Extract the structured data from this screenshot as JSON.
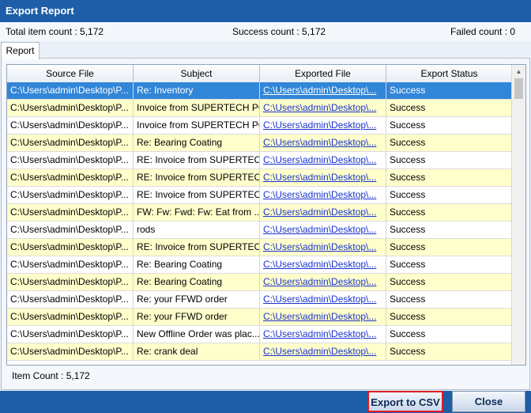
{
  "window": {
    "title": "Export Report"
  },
  "summary": {
    "total": "Total item count : 5,172",
    "success": "Success count : 5,172",
    "failed": "Failed count : 0"
  },
  "tabs": [
    {
      "label": "Report"
    }
  ],
  "table": {
    "headers": [
      "Source File",
      "Subject",
      "Exported File",
      "Export Status"
    ],
    "rows": [
      [
        "C:\\Users\\admin\\Desktop\\P...",
        "Re: Inventory",
        "C:\\Users\\admin\\Desktop\\...",
        "Success"
      ],
      [
        "C:\\Users\\admin\\Desktop\\P...",
        "Invoice from SUPERTECH PO...",
        "C:\\Users\\admin\\Desktop\\...",
        "Success"
      ],
      [
        "C:\\Users\\admin\\Desktop\\P...",
        "Invoice from SUPERTECH PO...",
        "C:\\Users\\admin\\Desktop\\...",
        "Success"
      ],
      [
        "C:\\Users\\admin\\Desktop\\P...",
        "Re: Bearing Coating",
        "C:\\Users\\admin\\Desktop\\...",
        "Success"
      ],
      [
        "C:\\Users\\admin\\Desktop\\P...",
        "RE: Invoice from SUPERTEC...",
        "C:\\Users\\admin\\Desktop\\...",
        "Success"
      ],
      [
        "C:\\Users\\admin\\Desktop\\P...",
        "RE: Invoice from SUPERTEC...",
        "C:\\Users\\admin\\Desktop\\...",
        "Success"
      ],
      [
        "C:\\Users\\admin\\Desktop\\P...",
        "RE: Invoice from SUPERTEC...",
        "C:\\Users\\admin\\Desktop\\...",
        "Success"
      ],
      [
        "C:\\Users\\admin\\Desktop\\P...",
        "FW: Fw: Fwd: Fw: Eat from ...",
        "C:\\Users\\admin\\Desktop\\...",
        "Success"
      ],
      [
        "C:\\Users\\admin\\Desktop\\P...",
        "rods",
        "C:\\Users\\admin\\Desktop\\...",
        "Success"
      ],
      [
        "C:\\Users\\admin\\Desktop\\P...",
        "RE: Invoice from SUPERTEC...",
        "C:\\Users\\admin\\Desktop\\...",
        "Success"
      ],
      [
        "C:\\Users\\admin\\Desktop\\P...",
        "Re: Bearing Coating",
        "C:\\Users\\admin\\Desktop\\...",
        "Success"
      ],
      [
        "C:\\Users\\admin\\Desktop\\P...",
        "Re: Bearing Coating",
        "C:\\Users\\admin\\Desktop\\...",
        "Success"
      ],
      [
        "C:\\Users\\admin\\Desktop\\P...",
        "Re: your FFWD order",
        "C:\\Users\\admin\\Desktop\\...",
        "Success"
      ],
      [
        "C:\\Users\\admin\\Desktop\\P...",
        "Re: your FFWD order",
        "C:\\Users\\admin\\Desktop\\...",
        "Success"
      ],
      [
        "C:\\Users\\admin\\Desktop\\P...",
        "New Offline Order was plac...",
        "C:\\Users\\admin\\Desktop\\...",
        "Success"
      ],
      [
        "C:\\Users\\admin\\Desktop\\P...",
        "Re: crank deal",
        "C:\\Users\\admin\\Desktop\\...",
        "Success"
      ]
    ],
    "selected_row": 0
  },
  "item_count": "Item Count :  5,172",
  "buttons": {
    "export_csv": "Export to CSV",
    "close": "Close"
  },
  "colors": {
    "titlebar": "#1e5ea8",
    "row_alt": "#ffffcc",
    "row_selected": "#3186d8",
    "link": "#1a33cc",
    "highlight_border": "#e01b24"
  },
  "icons": {
    "scroll_up": "chevron-up-icon"
  }
}
